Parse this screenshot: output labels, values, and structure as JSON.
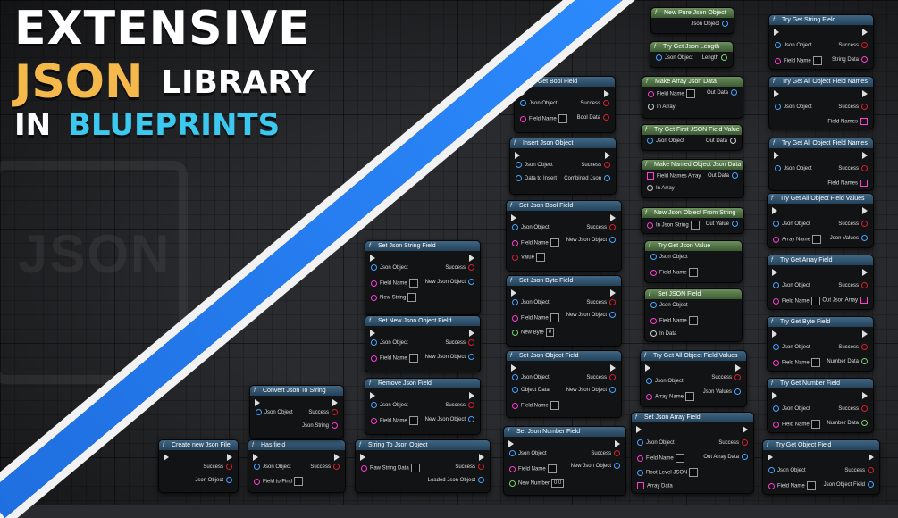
{
  "headline": {
    "line1": "EXTENSIVE",
    "line2_accent": "JSON",
    "line2_rest": "LIBRARY",
    "line3_plain": "IN",
    "line3_accent": "BLUEPRINTS"
  },
  "watermark": {
    "text": "JSON"
  },
  "colors": {
    "accent_blue": "#2d8cff",
    "accent_orange": "#f5b84a",
    "accent_cyan": "#3cc9f0"
  },
  "nodes": {
    "create_new_json_file": {
      "title": "Create new Json File",
      "pins": [
        "Success",
        "Json Object"
      ]
    },
    "has_field": {
      "title": "Has field",
      "pins": [
        "Json Object",
        "Success",
        "Field to Find"
      ]
    },
    "convert_json_to_string": {
      "title": "Convert Json To String",
      "pins": [
        "Json Object",
        "Success",
        "Json String"
      ]
    },
    "string_to_json_object": {
      "title": "String To Json Object",
      "pins": [
        "Success",
        "Raw String Data",
        "Loaded Json Object"
      ]
    },
    "set_json_string_field": {
      "title": "Set Json String Field",
      "pins": [
        "Json Object",
        "Success",
        "Field Name",
        "New Json Object",
        "New String"
      ]
    },
    "set_new_json_object_field": {
      "title": "Set New Json Object Field",
      "pins": [
        "Json Object",
        "Success",
        "Field Name",
        "New Json Object"
      ]
    },
    "remove_json_field": {
      "title": "Remove Json Field",
      "pins": [
        "Json Object",
        "Success",
        "Field Name",
        "New Json Object"
      ]
    },
    "try_get_bool_field": {
      "title": "Try Get Bool Field",
      "pins": [
        "Json Object",
        "Success",
        "Field Name",
        "Bool Data"
      ]
    },
    "insert_json_object": {
      "title": "Insert Json Object",
      "pins": [
        "Json Object",
        "Success",
        "Data to Insert",
        "Combined Json"
      ]
    },
    "set_json_bool_field": {
      "title": "Set Json Bool Field",
      "pins": [
        "Json Object",
        "Success",
        "Field Name",
        "New Json Object",
        "Value"
      ]
    },
    "set_json_byte_field": {
      "title": "Set Json Byte Field",
      "pins": [
        "Json Object",
        "Success",
        "Field Name",
        "New Json Object",
        "New Byte"
      ],
      "new_byte_value": "0"
    },
    "set_json_object_field": {
      "title": "Set Json Object Field",
      "pins": [
        "Json Object",
        "Success",
        "Object Data",
        "New Json Object",
        "Field Name"
      ]
    },
    "set_json_number_field": {
      "title": "Set Json Number Field",
      "pins": [
        "Json Object",
        "Success",
        "Field Name",
        "New Json Object",
        "New Number"
      ],
      "new_number_value": "0.0"
    },
    "new_pure_json_object": {
      "title": "New Pure Json Object",
      "pins": [
        "Json Object"
      ]
    },
    "try_get_json_length": {
      "title": "Try Get Json Length",
      "pins": [
        "Json Object",
        "Length"
      ]
    },
    "make_array_json_data": {
      "title": "Make Array Json Data",
      "pins": [
        "Field Name",
        "Out Data",
        "In Array"
      ]
    },
    "try_get_first_json_field_value": {
      "title": "Try Get First JSON Field Value",
      "pins": [
        "Json Object",
        "Out Data"
      ]
    },
    "make_named_object_json_data": {
      "title": "Make Named Object Json Data",
      "pins": [
        "Field Names Array",
        "Out Data",
        "In Array"
      ]
    },
    "new_json_object_from_string": {
      "title": "New Json Object From String",
      "pins": [
        "In Json String",
        "Out Value"
      ]
    },
    "try_get_json_value": {
      "title": "Try Get Json Value",
      "pins": [
        "Json Object",
        "Field Name"
      ]
    },
    "set_json_field": {
      "title": "Set JSON Field",
      "pins": [
        "Json Object",
        "Field Name",
        "In Data"
      ]
    },
    "try_get_all_object_field_values_mid": {
      "title": "Try Get All Object Field Values",
      "pins": [
        "Json Object",
        "Success",
        "Array Name",
        "Json Values"
      ]
    },
    "set_json_array_field": {
      "title": "Set Json Array Field",
      "pins": [
        "Json Object",
        "Success",
        "Field Name",
        "Out Array Data",
        "Root Level JSON",
        "Array Data"
      ]
    },
    "try_get_string_field": {
      "title": "Try Get String Field",
      "pins": [
        "Json Object",
        "Success",
        "Field Name",
        "String Data"
      ]
    },
    "try_get_all_object_field_names_1": {
      "title": "Try Get All Object Field Names",
      "pins": [
        "Json Object",
        "Success",
        "Field Names"
      ]
    },
    "try_get_all_object_field_names_2": {
      "title": "Try Get All Object Field Names",
      "pins": [
        "Json Object",
        "Success",
        "Field Names"
      ]
    },
    "try_get_all_object_field_values": {
      "title": "Try Get All Object Field Values",
      "pins": [
        "Json Object",
        "Success",
        "Array Name",
        "Json Values"
      ]
    },
    "try_get_array_field": {
      "title": "Try Get Array Field",
      "pins": [
        "Json Object",
        "Success",
        "Field Name",
        "Out Json Array"
      ]
    },
    "try_get_byte_field": {
      "title": "Try Get Byte Field",
      "pins": [
        "Json Object",
        "Success",
        "Field Name",
        "Number Data"
      ]
    },
    "try_get_number_field": {
      "title": "Try Get Number Field",
      "pins": [
        "Json Object",
        "Success",
        "Field Name",
        "Number Data"
      ]
    },
    "try_get_object_field": {
      "title": "Try Get Object Field",
      "pins": [
        "Json Object",
        "Success",
        "Field Name",
        "Json Object Field"
      ]
    }
  }
}
